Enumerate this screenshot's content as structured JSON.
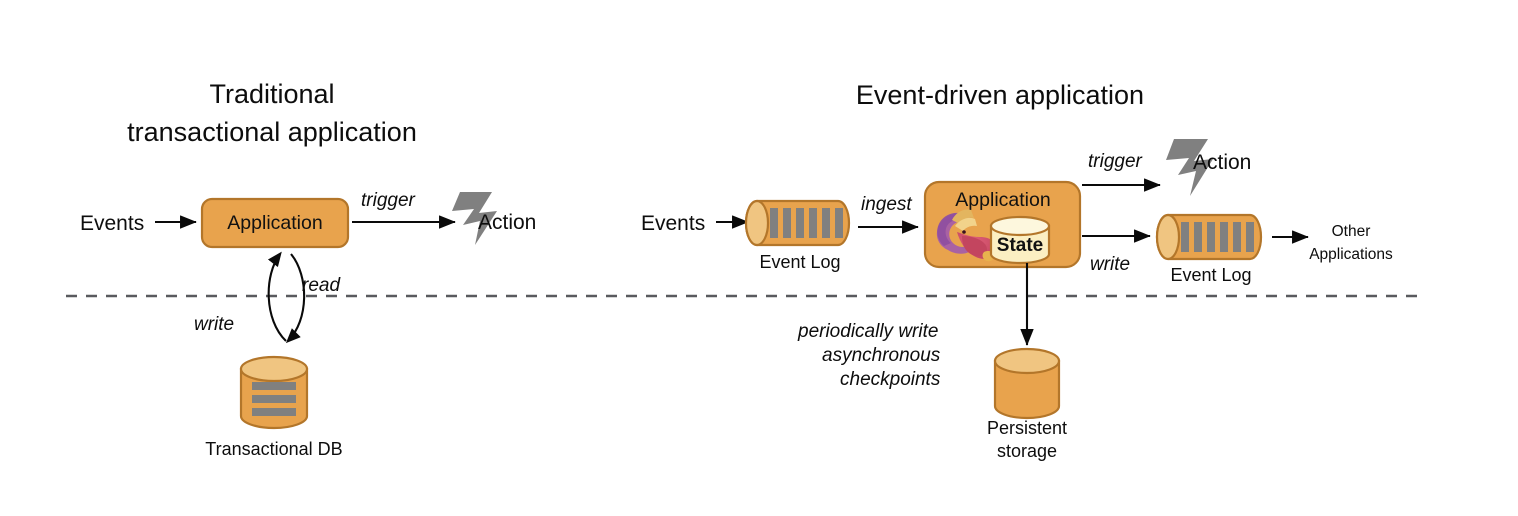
{
  "diagram": {
    "title": "Traditional transactional application vs Event-driven application",
    "separator": {
      "style": "dashed",
      "color": "#595a5e"
    },
    "palette": {
      "orange_body": "#e8a34d",
      "orange_top": "#f0c581",
      "orange_stroke": "#b3762a",
      "gray_bar": "#808080",
      "cream_body": "#fbefc2",
      "bolt_gray": "#808080",
      "text": "#0d0d0d"
    }
  },
  "left": {
    "title_line1": "Traditional",
    "title_line2": "transactional application",
    "events_label": "Events",
    "app_box_label": "Application",
    "trigger_label": "trigger",
    "action_label": "Action",
    "read_label": "read",
    "write_label": "write",
    "db_label": "Transactional DB",
    "db_bars": 3
  },
  "right": {
    "title": "Event-driven application",
    "events_label": "Events",
    "event_log_in_label": "Event Log",
    "event_log_in_bars": 6,
    "ingest_label": "ingest",
    "app_box_label": "Application",
    "app_logo": "flink-squirrel-logo",
    "state_label": "State",
    "trigger_label": "trigger",
    "action_label": "Action",
    "write_label": "write",
    "event_log_out_label": "Event Log",
    "event_log_out_bars": 6,
    "other_apps_line1": "Other",
    "other_apps_line2": "Applications",
    "checkpoint_line1": "periodically write",
    "checkpoint_line2": "asynchronous",
    "checkpoint_line3": "checkpoints",
    "storage_line1": "Persistent",
    "storage_line2": "storage"
  }
}
